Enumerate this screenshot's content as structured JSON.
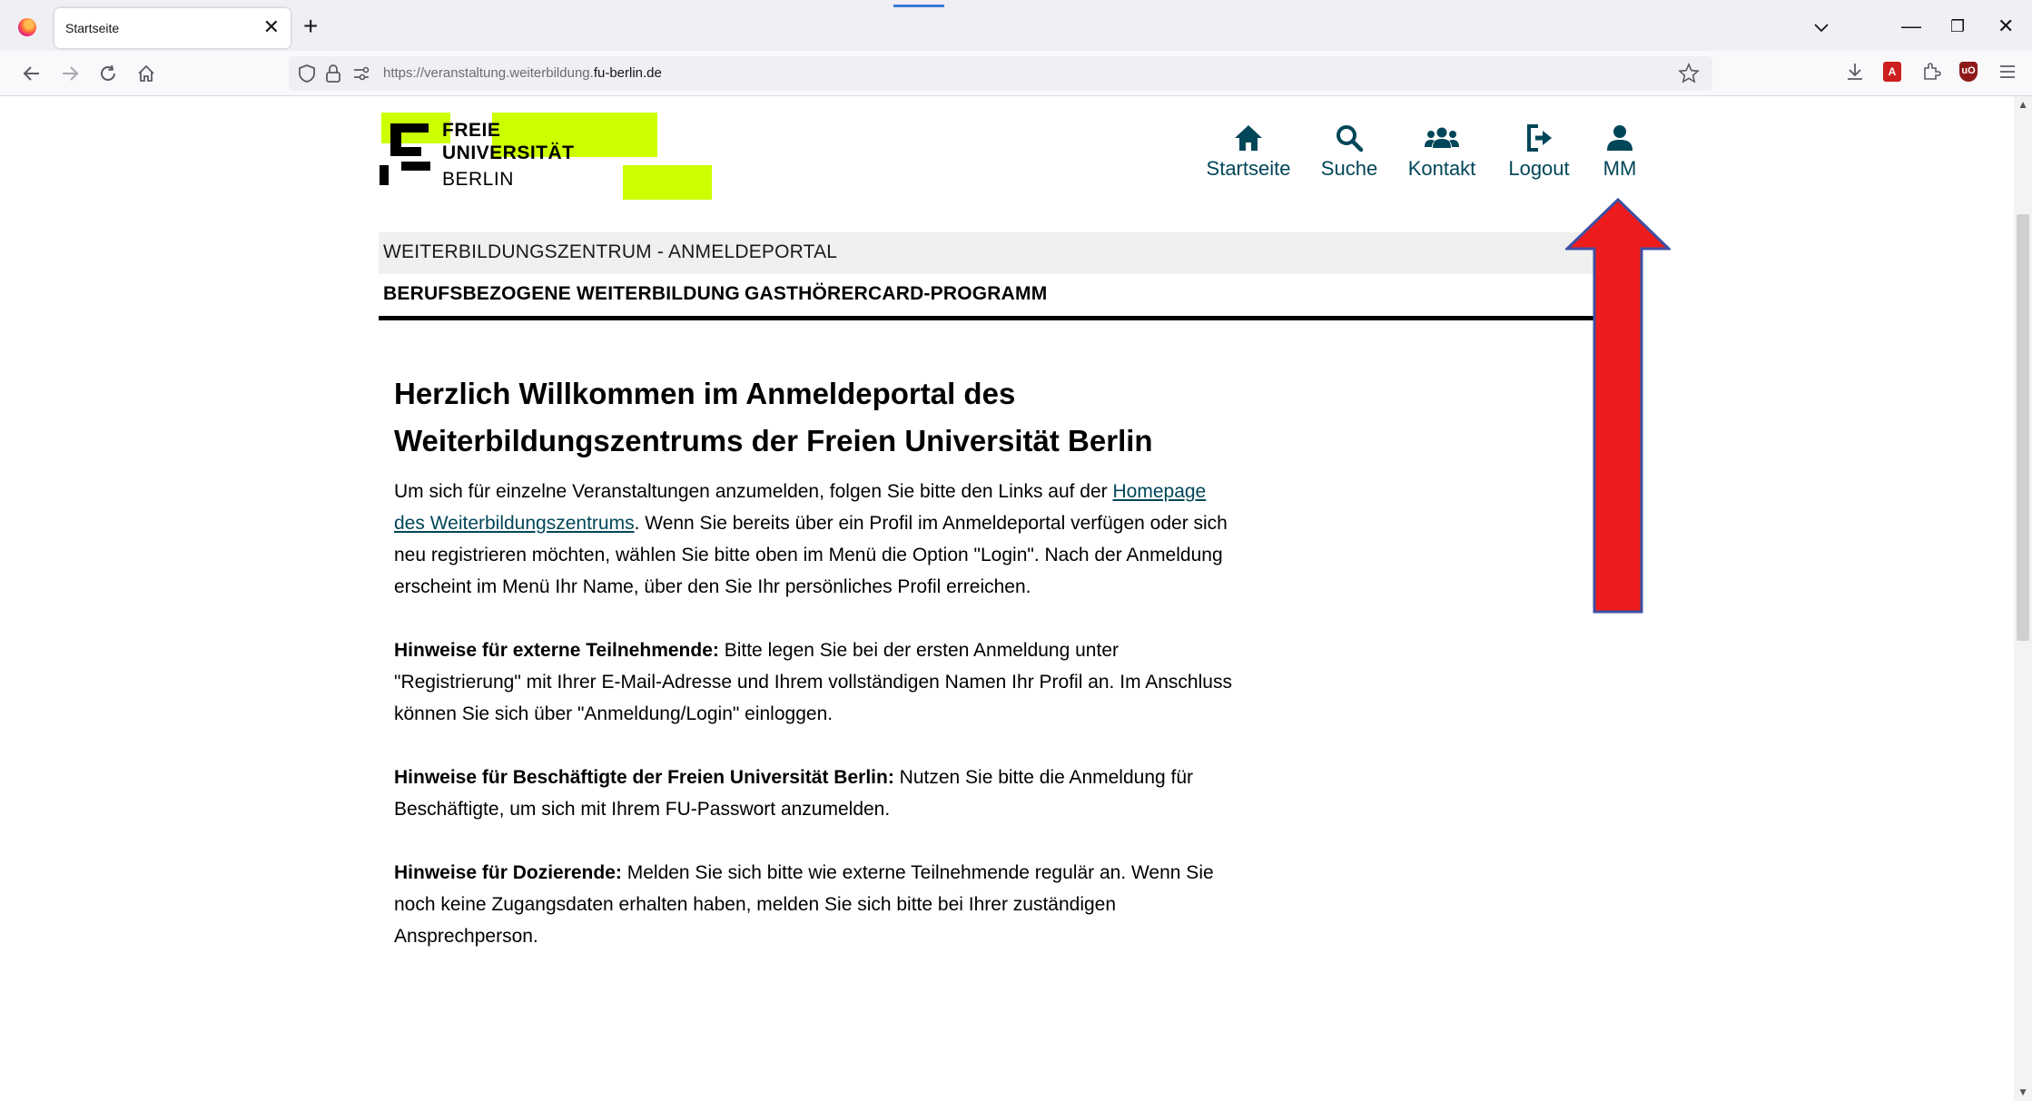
{
  "browser": {
    "tab_title": "Startseite",
    "tab_close": "✕",
    "new_tab": "+",
    "url_prefix": "https://veranstaltung.weiterbildung.",
    "url_domain": "fu-berlin.de",
    "window_minimize": "—",
    "window_restore": "❐",
    "window_close": "✕"
  },
  "logo": {
    "line1": "FREIE",
    "line2": "UNIVERSITÄT",
    "line3": "BERLIN",
    "highlight_color": "#ccff00"
  },
  "site_nav": [
    {
      "label": "Startseite",
      "icon": "home-icon"
    },
    {
      "label": "Suche",
      "icon": "search-icon"
    },
    {
      "label": "Kontakt",
      "icon": "users-icon"
    },
    {
      "label": "Logout",
      "icon": "logout-icon"
    },
    {
      "label": "MM",
      "icon": "user-icon"
    }
  ],
  "portal_title": "WEITERBILDUNGSZENTRUM - ANMELDEPORTAL",
  "menu": {
    "item1": "BERUFSBEZOGENE WEITERBILDUNG",
    "item2": "GASTHÖRERCARD-PROGRAMM"
  },
  "content": {
    "heading": "Herzlich Willkommen im Anmeldeportal des Weiterbildungszentrums der Freien Universität Berlin",
    "intro_before_link": "Um sich für einzelne Veranstaltungen anzumelden, folgen Sie bitte den Links auf der ",
    "intro_link": "Homepage des Weiterbildungszentrums",
    "intro_after_link": ". Wenn Sie bereits über ein Profil im Anmeldeportal verfügen oder sich neu registrieren möchten, wählen Sie bitte oben im Menü die Option \"Login\". Nach der Anmeldung erscheint im Menü Ihr Name, über den Sie Ihr persönliches Profil erreichen.",
    "external_label": "Hinweise für externe Teilnehmende:",
    "external_text": " Bitte legen Sie bei der ersten Anmeldung unter \"Registrierung\" mit Ihrer E-Mail-Adresse und Ihrem vollständigen Namen Ihr Profil an. Im Anschluss können Sie sich über \"Anmeldung/Login\" einloggen.",
    "staff_label": "Hinweise für Beschäftigte der Freien Universität Berlin:",
    "staff_text": " Nutzen Sie bitte die Anmeldung für Beschäftigte, um sich mit Ihrem FU-Passwort anzumelden.",
    "lecturer_label": "Hinweise für Dozierende:",
    "lecturer_text": " Melden Sie sich bitte wie externe Teilnehmende regulär an. Wenn Sie noch keine Zugangsdaten erhalten haben, melden Sie sich bitte bei Ihrer zuständigen Ansprechperson."
  },
  "colors": {
    "nav_text": "#004659",
    "arrow_fill": "#ee1c1c",
    "arrow_outline": "#3f4fa3"
  }
}
